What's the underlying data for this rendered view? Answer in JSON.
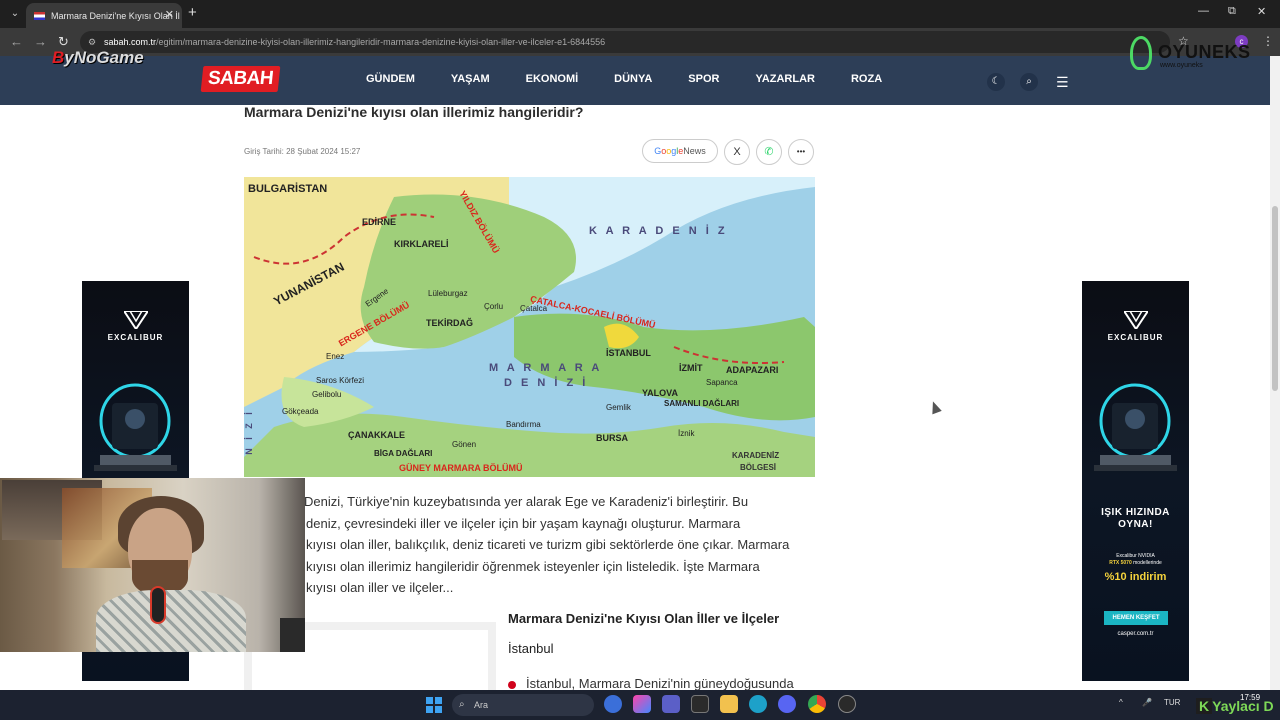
{
  "browser": {
    "tab_title": "Marmara Denizi'ne Kıyısı Olan İl",
    "tab_close": "✕",
    "new_tab": "+",
    "menu": "⌄",
    "url_host": "sabah.com.tr",
    "url_path": "/egitim/marmara-denizine-kiyisi-olan-illerimiz-hangileridir-marmara-denizine-kiyisi-olan-iller-ve-ilceler-e1-6844556",
    "profile_initial": "c",
    "win_min": "—",
    "win_max": "⧉",
    "win_close": "✕"
  },
  "overlays": {
    "bynogame_b": "B",
    "bynogame_rest": "yNoGame",
    "oyuneks": "OYUNEKS",
    "oyuneks_sub": "www.oyuneks"
  },
  "site": {
    "logo": "SABAH",
    "nav": [
      "GÜNDEM",
      "YAŞAM",
      "EKONOMİ",
      "DÜNYA",
      "SPOR",
      "YAZARLAR",
      "ROZA"
    ]
  },
  "article": {
    "headline": "Marmara Denizi'ne kıyısı olan illerimiz hangileridir?",
    "date": "Giriş Tarihi: 28 Şubat 2024 15:27",
    "gnews_google": [
      "G",
      "o",
      "o",
      "g",
      "l",
      "e"
    ],
    "gnews_news": "News",
    "share_x": "X",
    "share_more": "•••",
    "body_lines": [
      "Denizi, Türkiye'nin kuzeybatısında yer alarak Ege ve Karadeniz'i birleştirir. Bu",
      "deniz, çevresindeki iller ve ilçeler için bir yaşam kaynağı oluşturur. Marmara",
      "kıyısı olan iller, balıkçılık, deniz ticareti ve turizm gibi sektörlerde öne çıkar. Marmara",
      "kıyısı olan illerimiz hangileridir öğrenmek isteyenler için listeledik. İşte Marmara",
      "kıyısı olan iller ve ilçeler..."
    ],
    "subhead": "Marmara Denizi'ne Kıyısı Olan İller ve İlçeler",
    "city": "İstanbul",
    "bullet_text": "İstanbul, Marmara Denizi'nin güneydoğusunda"
  },
  "map": {
    "labels": {
      "bulgaristan": "BULGARİSTAN",
      "yunanistan": "YUNANİSTAN",
      "karadeniz": "K A R A D E N İ Z",
      "marmara": "M A R M A R A",
      "denizi": "D E N İ Z İ",
      "edirne": "EDİRNE",
      "kirklareli": "KIRKLARELİ",
      "luleburgaz": "Lüleburgaz",
      "tekirdag": "TEKİRDAĞ",
      "istanbul": "İSTANBUL",
      "izmit": "İZMİT",
      "adapazari": "ADAPAZARI",
      "yalova": "YALOVA",
      "bursa": "BURSA",
      "canakkale": "ÇANAKKALE",
      "gelibolu": "Gelibolu",
      "gokceada": "Gökçeada",
      "saros": "Saros Körfezi",
      "bandirma": "Bandırma",
      "gonen": "Gönen",
      "enez": "Enez",
      "ergene": "Ergene",
      "catalca": "Çatalca",
      "corlu": "Çorlu",
      "gemlik": "Gemlik",
      "iznik": "İznik",
      "sapanca": "Sapanca",
      "biga": "BİGA DAĞLARI",
      "samanli": "SAMANLI DAĞLARI",
      "kaciadalar": "KARADENİZ",
      "bolgesi": "BÖLGESİ",
      "yildiz_bolumu": "YILDIZ BÖLÜMÜ",
      "ergene_bolumu": "ERGENE BÖLÜMÜ",
      "catalca_kocaeli": "ÇATALCA-KOCAELİ BÖLÜMÜ",
      "guney_marmara": "GÜNEY MARMARA BÖLÜMÜ",
      "nizi": "N İ Z İ"
    }
  },
  "ad": {
    "brand": "EXCALIBUR",
    "slogan_1": "IŞIK HIZINDA",
    "slogan_2": "OYNA!",
    "small_1": "Excalibur NVIDIA",
    "small_2": "RTX 5070",
    "small_3": "modellerinde",
    "discount": "%10 indirim",
    "cta": "HEMEN KEŞFET",
    "site": "casper.com.tr"
  },
  "taskbar": {
    "search": "Ara",
    "lang": "TUR",
    "time": "17:59",
    "watermark_k": "K",
    "watermark": "Yaylacı D"
  },
  "colors": {
    "header_bg": "#2d3e57",
    "logo_red": "#e11d23",
    "bullet_red": "#d0021b"
  }
}
